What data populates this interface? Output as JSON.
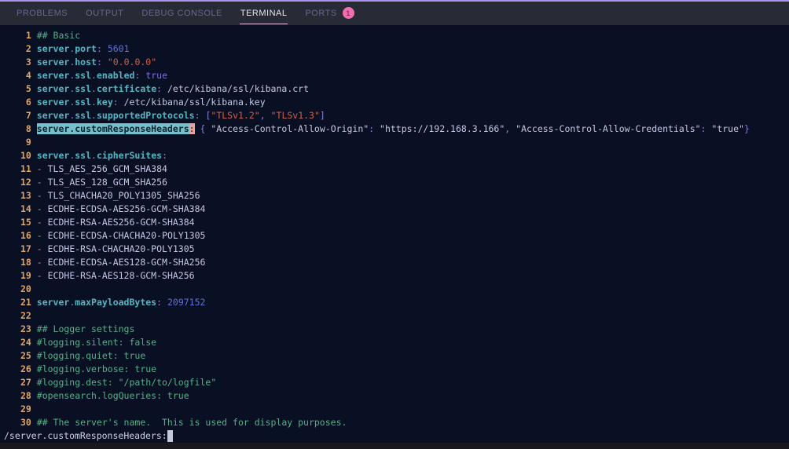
{
  "colors": {
    "panel_border": "#ab94ea",
    "panel_bg": "#282a36",
    "tab_inactive": "#646a8e",
    "tab_active": "#e6e7f2",
    "tab_underline": "#dfb7d8",
    "badge_bg": "#f06daf",
    "badge_text": "#8d2e5e",
    "terminal_bg": "#0a1023",
    "line_number": "#e0a569",
    "comment": "#55b08a",
    "key": "#53b7c4",
    "punct": "#8a7ce0",
    "number": "#5e72dd",
    "boolean": "#7e72e0",
    "string": "#c9614f",
    "plain": "#c3c8e6",
    "dash": "#d78a92",
    "match_bg": "#74c0cb",
    "match_text": "#0c2430",
    "match_colon_bg": "#eda09b",
    "cmd_text": "#ccd0e4",
    "cursor": "#c3c9d8",
    "bottom_strip": "#18181e"
  },
  "panel_tabs": {
    "items": [
      {
        "label": "PROBLEMS",
        "active": false
      },
      {
        "label": "OUTPUT",
        "active": false
      },
      {
        "label": "DEBUG CONSOLE",
        "active": false
      },
      {
        "label": "TERMINAL",
        "active": true
      },
      {
        "label": "PORTS",
        "active": false
      }
    ],
    "ports_badge": "1"
  },
  "terminal": {
    "command_line": "/server.customResponseHeaders:",
    "lines": [
      {
        "num": "1",
        "segments": [
          {
            "s": "c",
            "t": "## Basic"
          }
        ]
      },
      {
        "num": "2",
        "segments": [
          {
            "s": "k",
            "t": "server"
          },
          {
            "s": "p",
            "t": "."
          },
          {
            "s": "k",
            "t": "port"
          },
          {
            "s": "p",
            "t": ":"
          },
          {
            "s": "w",
            "t": " "
          },
          {
            "s": "n",
            "t": "5601"
          }
        ]
      },
      {
        "num": "3",
        "segments": [
          {
            "s": "k",
            "t": "server"
          },
          {
            "s": "p",
            "t": "."
          },
          {
            "s": "k",
            "t": "host"
          },
          {
            "s": "p",
            "t": ":"
          },
          {
            "s": "w",
            "t": " "
          },
          {
            "s": "s",
            "t": "\"0.0.0.0\""
          }
        ]
      },
      {
        "num": "4",
        "segments": [
          {
            "s": "k",
            "t": "server"
          },
          {
            "s": "p",
            "t": "."
          },
          {
            "s": "k",
            "t": "ssl"
          },
          {
            "s": "p",
            "t": "."
          },
          {
            "s": "k",
            "t": "enabled"
          },
          {
            "s": "p",
            "t": ":"
          },
          {
            "s": "w",
            "t": " "
          },
          {
            "s": "b",
            "t": "true"
          }
        ]
      },
      {
        "num": "5",
        "segments": [
          {
            "s": "k",
            "t": "server"
          },
          {
            "s": "p",
            "t": "."
          },
          {
            "s": "k",
            "t": "ssl"
          },
          {
            "s": "p",
            "t": "."
          },
          {
            "s": "k",
            "t": "certificate"
          },
          {
            "s": "p",
            "t": ":"
          },
          {
            "s": "w",
            "t": " /etc/kibana/ssl/kibana.crt"
          }
        ]
      },
      {
        "num": "6",
        "segments": [
          {
            "s": "k",
            "t": "server"
          },
          {
            "s": "p",
            "t": "."
          },
          {
            "s": "k",
            "t": "ssl"
          },
          {
            "s": "p",
            "t": "."
          },
          {
            "s": "k",
            "t": "key"
          },
          {
            "s": "p",
            "t": ":"
          },
          {
            "s": "w",
            "t": " /etc/kibana/ssl/kibana.key"
          }
        ]
      },
      {
        "num": "7",
        "segments": [
          {
            "s": "k",
            "t": "server"
          },
          {
            "s": "p",
            "t": "."
          },
          {
            "s": "k",
            "t": "ssl"
          },
          {
            "s": "p",
            "t": "."
          },
          {
            "s": "k",
            "t": "supportedProtocols"
          },
          {
            "s": "p",
            "t": ":"
          },
          {
            "s": "w",
            "t": " "
          },
          {
            "s": "p",
            "t": "["
          },
          {
            "s": "s",
            "t": "\"TLSv1.2\""
          },
          {
            "s": "p",
            "t": ","
          },
          {
            "s": "w",
            "t": " "
          },
          {
            "s": "s",
            "t": "\"TLSv1.3\""
          },
          {
            "s": "p",
            "t": "]"
          }
        ]
      },
      {
        "num": "8",
        "segments": [
          {
            "s": "hk",
            "t": "server.customResponseHeaders"
          },
          {
            "s": "hp",
            "t": ":"
          },
          {
            "s": "w",
            "t": " "
          },
          {
            "s": "p",
            "t": "{"
          },
          {
            "s": "w",
            "t": " \"Access-Control-Allow-Origin\""
          },
          {
            "s": "p",
            "t": ":"
          },
          {
            "s": "w",
            "t": " \"https://192.168.3.166\""
          },
          {
            "s": "p",
            "t": ","
          },
          {
            "s": "w",
            "t": " \"Access-Control-Allow-Credentials\""
          },
          {
            "s": "p",
            "t": ":"
          },
          {
            "s": "w",
            "t": " \"true\""
          },
          {
            "s": "p",
            "t": "}"
          }
        ]
      },
      {
        "num": "9",
        "segments": []
      },
      {
        "num": "10",
        "segments": [
          {
            "s": "k",
            "t": "server"
          },
          {
            "s": "p",
            "t": "."
          },
          {
            "s": "k",
            "t": "ssl"
          },
          {
            "s": "p",
            "t": "."
          },
          {
            "s": "k",
            "t": "cipherSuites"
          },
          {
            "s": "p",
            "t": ":"
          }
        ]
      },
      {
        "num": "11",
        "segments": [
          {
            "s": "d",
            "t": "-"
          },
          {
            "s": "w",
            "t": " TLS_AES_256_GCM_SHA384"
          }
        ]
      },
      {
        "num": "12",
        "segments": [
          {
            "s": "d",
            "t": "-"
          },
          {
            "s": "w",
            "t": " TLS_AES_128_GCM_SHA256"
          }
        ]
      },
      {
        "num": "13",
        "segments": [
          {
            "s": "d",
            "t": "-"
          },
          {
            "s": "w",
            "t": " TLS_CHACHA20_POLY1305_SHA256"
          }
        ]
      },
      {
        "num": "14",
        "segments": [
          {
            "s": "d",
            "t": "-"
          },
          {
            "s": "w",
            "t": " ECDHE-ECDSA-AES256-GCM-SHA384"
          }
        ]
      },
      {
        "num": "15",
        "segments": [
          {
            "s": "d",
            "t": "-"
          },
          {
            "s": "w",
            "t": " ECDHE-RSA-AES256-GCM-SHA384"
          }
        ]
      },
      {
        "num": "16",
        "segments": [
          {
            "s": "d",
            "t": "-"
          },
          {
            "s": "w",
            "t": " ECDHE-ECDSA-CHACHA20-POLY1305"
          }
        ]
      },
      {
        "num": "17",
        "segments": [
          {
            "s": "d",
            "t": "-"
          },
          {
            "s": "w",
            "t": " ECDHE-RSA-CHACHA20-POLY1305"
          }
        ]
      },
      {
        "num": "18",
        "segments": [
          {
            "s": "d",
            "t": "-"
          },
          {
            "s": "w",
            "t": " ECDHE-ECDSA-AES128-GCM-SHA256"
          }
        ]
      },
      {
        "num": "19",
        "segments": [
          {
            "s": "d",
            "t": "-"
          },
          {
            "s": "w",
            "t": " ECDHE-RSA-AES128-GCM-SHA256"
          }
        ]
      },
      {
        "num": "20",
        "segments": []
      },
      {
        "num": "21",
        "segments": [
          {
            "s": "k",
            "t": "server"
          },
          {
            "s": "p",
            "t": "."
          },
          {
            "s": "k",
            "t": "maxPayloadBytes"
          },
          {
            "s": "p",
            "t": ":"
          },
          {
            "s": "w",
            "t": " "
          },
          {
            "s": "n",
            "t": "2097152"
          }
        ]
      },
      {
        "num": "22",
        "segments": []
      },
      {
        "num": "23",
        "segments": [
          {
            "s": "c",
            "t": "## Logger settings"
          }
        ]
      },
      {
        "num": "24",
        "segments": [
          {
            "s": "c",
            "t": "#logging.silent: false"
          }
        ]
      },
      {
        "num": "25",
        "segments": [
          {
            "s": "c",
            "t": "#logging.quiet: true"
          }
        ]
      },
      {
        "num": "26",
        "segments": [
          {
            "s": "c",
            "t": "#logging.verbose: true"
          }
        ]
      },
      {
        "num": "27",
        "segments": [
          {
            "s": "c",
            "t": "#logging.dest: \"/path/to/logfile\""
          }
        ]
      },
      {
        "num": "28",
        "segments": [
          {
            "s": "c",
            "t": "#opensearch.logQueries: true"
          }
        ]
      },
      {
        "num": "29",
        "segments": []
      },
      {
        "num": "30",
        "segments": [
          {
            "s": "c",
            "t": "## The server's name.  This is used for display purposes."
          }
        ]
      }
    ]
  }
}
